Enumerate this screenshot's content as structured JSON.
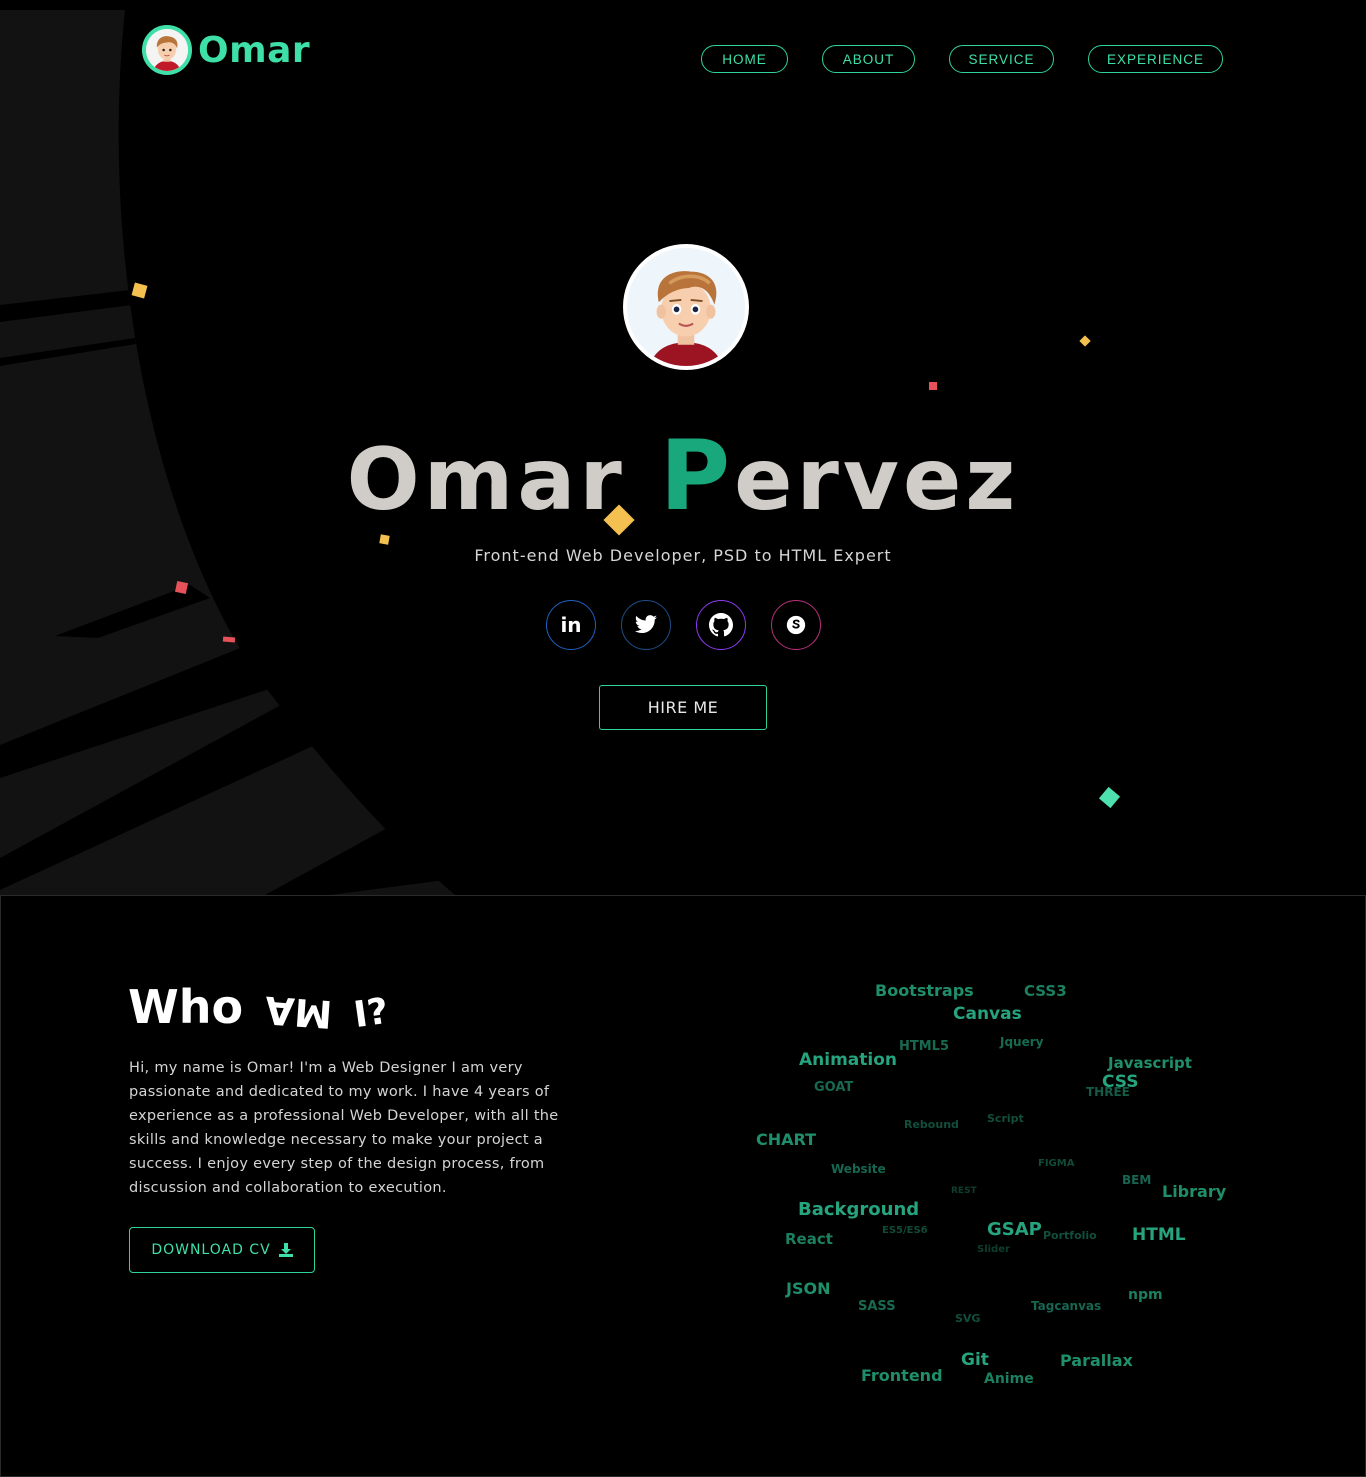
{
  "header": {
    "logo_text": "Omar",
    "nav": [
      {
        "label": "HOME"
      },
      {
        "label": "ABOUT"
      },
      {
        "label": "SERVICE"
      },
      {
        "label": "EXPERIENCE"
      }
    ]
  },
  "hero": {
    "name_first": "Omar",
    "name_initial": "P",
    "name_rest": "ervez",
    "subtitle": "Front-end Web Developer, PSD to HTML Expert",
    "socials": [
      {
        "icon": "linkedin-icon",
        "glyph": "in"
      },
      {
        "icon": "twitter-icon"
      },
      {
        "icon": "github-icon"
      },
      {
        "icon": "skype-icon"
      }
    ],
    "hire_label": "HIRE ME"
  },
  "about": {
    "title_left": "Who",
    "title_mid": "AM",
    "title_right": "I?",
    "paragraph": "Hi, my name is Omar! I'm a Web Designer I am very passionate and dedicated to my work. I have 4 years of experience as a professional Web Developer, with all the skills and knowledge necessary to make your project a success. I enjoy every step of the design process, from discussion and collaboration to execution.",
    "cv_label": "DOWNLOAD CV",
    "tags": [
      "Bootstraps",
      "CSS3",
      "Canvas",
      "HTML5",
      "Jquery",
      "Animation",
      "Javascript",
      "GOAT",
      "CSS",
      "THREE",
      "Rebound",
      "Script",
      "CHART",
      "Website",
      "FIGMA",
      "BEM",
      "Library",
      "REST",
      "Background",
      "GSAP",
      "React",
      "ES5/ES6",
      "Portfolio",
      "HTML",
      "Slider",
      "JSON",
      "SASS",
      "SVG",
      "Tagcanvas",
      "npm",
      "Git",
      "Frontend",
      "Parallax",
      "Anime"
    ]
  },
  "colors": {
    "accent": "#3ee0a8",
    "accent_dark": "#19a77c",
    "background": "#000000",
    "name_text": "#d0ccc8"
  }
}
